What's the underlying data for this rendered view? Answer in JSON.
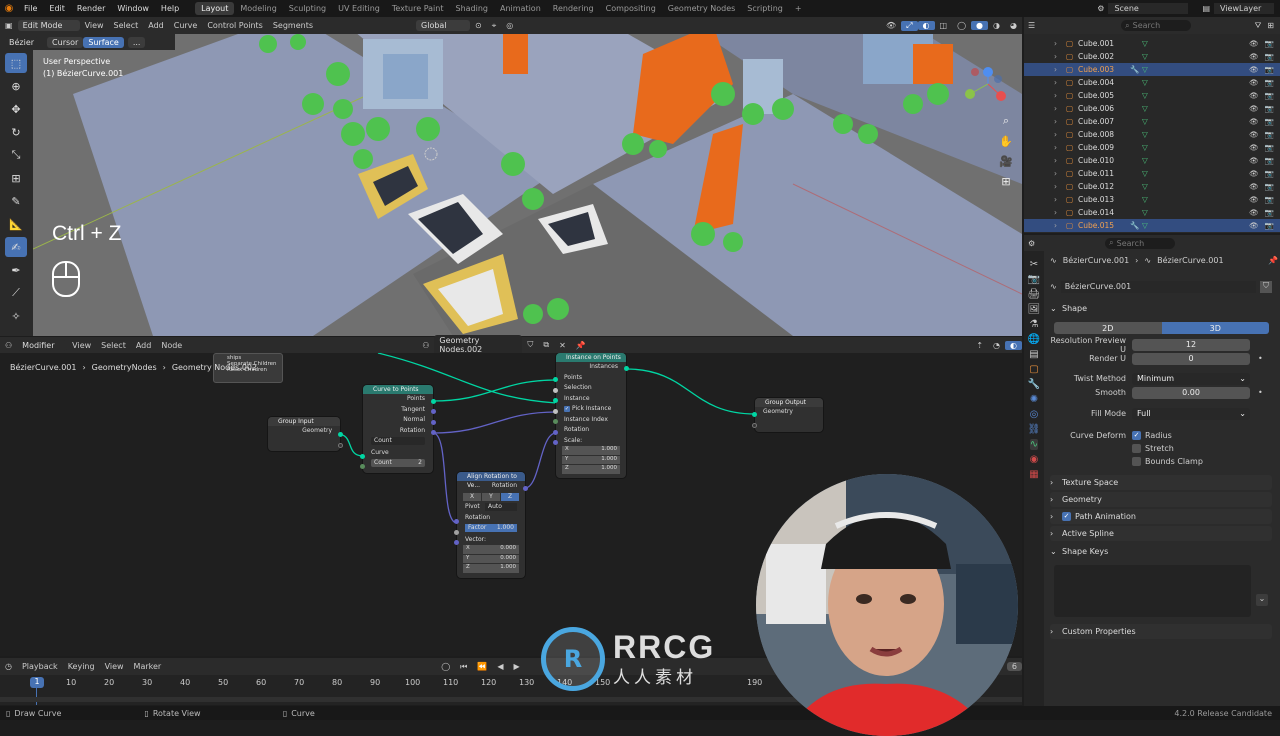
{
  "menu": {
    "items": [
      "File",
      "Edit",
      "Render",
      "Window",
      "Help"
    ]
  },
  "workspaces": {
    "tabs": [
      "Layout",
      "Modeling",
      "Sculpting",
      "UV Editing",
      "Texture Paint",
      "Shading",
      "Animation",
      "Rendering",
      "Compositing",
      "Geometry Nodes",
      "Scripting"
    ],
    "active": "Layout"
  },
  "scene": {
    "name": "Scene",
    "view_layer": "ViewLayer"
  },
  "viewport": {
    "mode": "Edit Mode",
    "menus": [
      "View",
      "Select",
      "Add",
      "Curve",
      "Control Points",
      "Segments"
    ],
    "transform": "Global",
    "curve_type": "Bézier",
    "cursor_btn": "Cursor",
    "surface_btn": "Surface",
    "dots_btn": "...",
    "perspective": "User Perspective",
    "object_label": "(1) BézierCurve.001",
    "shortcut_text": "Ctrl + Z"
  },
  "node_editor": {
    "editor_type": "Modifier",
    "menus": [
      "View",
      "Select",
      "Add",
      "Node"
    ],
    "tree_name": "Geometry Nodes.002",
    "breadcrumb": [
      "BézierCurve.001",
      "GeometryNodes",
      "Geometry Nodes.002"
    ],
    "popup": {
      "item1": "ships",
      "item2": "Separate Children",
      "item3": "Reset Children"
    },
    "group_input": {
      "title": "Group Input",
      "geometry": "Geometry"
    },
    "curve_to_points": {
      "title": "Curve to Points",
      "outputs": [
        "Points",
        "Tangent",
        "Normal",
        "Rotation"
      ],
      "mode": "Count",
      "curve": "Curve",
      "count_label": "Count",
      "count_value": "2"
    },
    "align_rotation": {
      "title": "Align Rotation to Ve...",
      "rotation_out": "Rotation",
      "axes": [
        "X",
        "Y",
        "Z"
      ],
      "pivot_label": "Pivot",
      "pivot_value": "Auto",
      "rotation_in": "Rotation",
      "factor_label": "Factor",
      "factor_value": "1.000",
      "vector_label": "Vector:",
      "vector": [
        [
          "X",
          "0.000"
        ],
        [
          "Y",
          "0.000"
        ],
        [
          "Z",
          "1.000"
        ]
      ]
    },
    "instance_on_points": {
      "title": "Instance on Points",
      "instances": "Instances",
      "inputs": [
        "Points",
        "Selection",
        "Instance"
      ],
      "pick_instance": "Pick Instance",
      "instance_index": "Instance Index",
      "rotation": "Rotation",
      "scale": "Scale:",
      "scale_values": [
        [
          "X",
          "1.000"
        ],
        [
          "Y",
          "1.000"
        ],
        [
          "Z",
          "1.000"
        ]
      ]
    },
    "group_output": {
      "title": "Group Output",
      "geometry": "Geometry"
    }
  },
  "timeline": {
    "menus": [
      "Playback",
      "Keying",
      "View",
      "Marker"
    ],
    "frames": [
      "10",
      "20",
      "30",
      "40",
      "50",
      "60",
      "70",
      "80",
      "90",
      "100",
      "110",
      "120",
      "130",
      "140",
      "150",
      "190"
    ],
    "current_frame": "1",
    "end_frame": "6"
  },
  "statusbar": {
    "items": [
      "Draw Curve",
      "Rotate View",
      "Curve"
    ],
    "version": "4.2.0 Release Candidate"
  },
  "outliner": {
    "search_placeholder": "Search",
    "items": [
      "Cube.001",
      "Cube.002",
      "Cube.003",
      "Cube.004",
      "Cube.005",
      "Cube.006",
      "Cube.007",
      "Cube.008",
      "Cube.009",
      "Cube.010",
      "Cube.011",
      "Cube.012",
      "Cube.013",
      "Cube.014",
      "Cube.015"
    ],
    "highlighted": [
      "Cube.003",
      "Cube.015"
    ]
  },
  "properties": {
    "search_placeholder": "Search",
    "breadcrumb_object": "BézierCurve.001",
    "breadcrumb_data": "BézierCurve.001",
    "data_name": "BézierCurve.001",
    "shape_panel": "Shape",
    "dim_2d": "2D",
    "dim_3d": "3D",
    "resolution_label": "Resolution Preview U",
    "resolution_value": "12",
    "render_u_label": "Render U",
    "render_u_value": "0",
    "twist_label": "Twist Method",
    "twist_value": "Minimum",
    "smooth_label": "Smooth",
    "smooth_value": "0.00",
    "fill_label": "Fill Mode",
    "fill_value": "Full",
    "deform_label": "Curve Deform",
    "radius": "Radius",
    "stretch": "Stretch",
    "bounds_clamp": "Bounds Clamp",
    "panels": [
      "Texture Space",
      "Geometry",
      "Path Animation",
      "Active Spline",
      "Shape Keys",
      "Custom Properties"
    ]
  },
  "watermark": {
    "brand": "RRCG",
    "sub": "人人素材"
  },
  "colors": {
    "accent": "#4772b3",
    "socket_geo": "#00d6a3",
    "socket_vec": "#6363c7",
    "socket_float": "#a1a1a1",
    "socket_int": "#598c5c",
    "orange_building": "#e86a1c",
    "tree_green": "#4fc24f"
  }
}
